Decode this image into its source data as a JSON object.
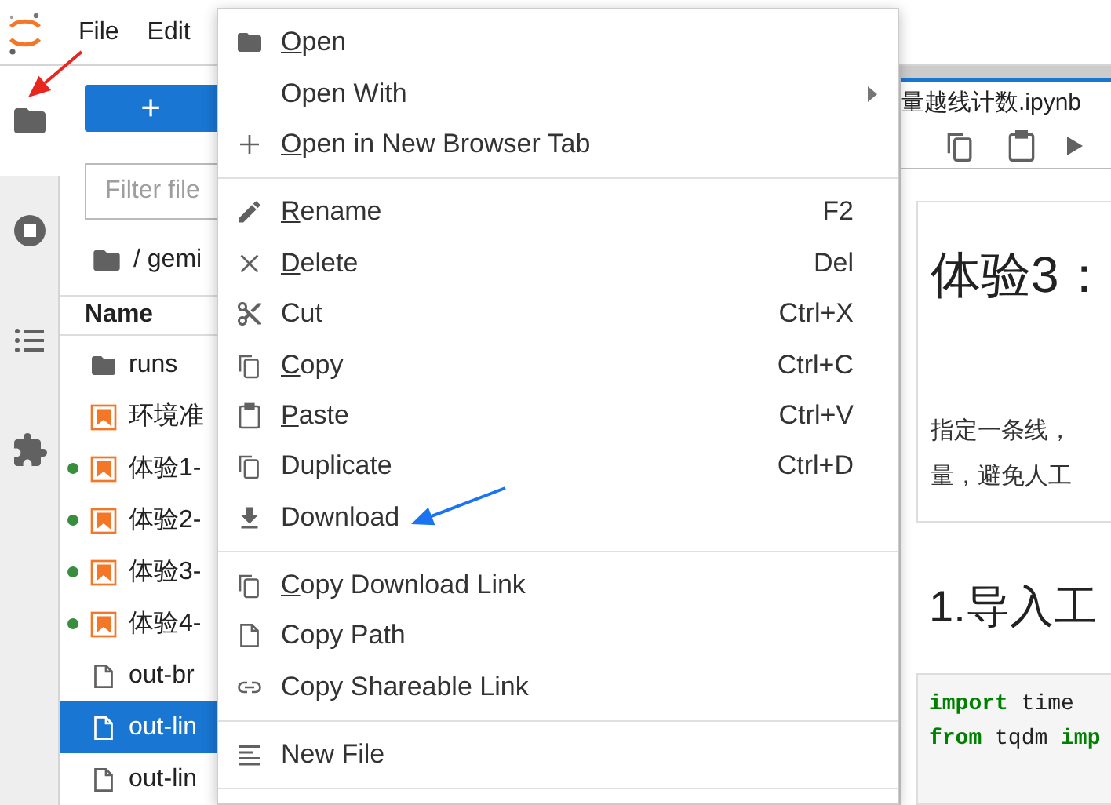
{
  "menubar": {
    "items": [
      "File",
      "Edit"
    ]
  },
  "sidebar_tabs": [
    {
      "selected": true
    },
    {
      "selected": false
    },
    {
      "selected": false
    },
    {
      "selected": false
    }
  ],
  "file_browser": {
    "new_button": "+",
    "filter": {
      "placeholder": "Filter file"
    },
    "breadcrumb": "/ gemi",
    "column_header": "Name",
    "rows": [
      {
        "kind": "folder",
        "name": "runs",
        "running": false,
        "selected": false
      },
      {
        "kind": "notebook",
        "name": "环境准",
        "running": false,
        "selected": false
      },
      {
        "kind": "notebook",
        "name": "体验1-",
        "running": true,
        "selected": false
      },
      {
        "kind": "notebook",
        "name": "体验2-",
        "running": true,
        "selected": false
      },
      {
        "kind": "notebook",
        "name": "体验3-",
        "running": true,
        "selected": false
      },
      {
        "kind": "notebook",
        "name": "体验4-",
        "running": true,
        "selected": false
      },
      {
        "kind": "file",
        "name": "out-br",
        "running": false,
        "selected": false
      },
      {
        "kind": "file",
        "name": "out-lin",
        "running": false,
        "selected": true
      },
      {
        "kind": "file",
        "name": "out-lin",
        "running": false,
        "selected": false
      }
    ]
  },
  "context_menu": {
    "sections": [
      [
        {
          "label": "Open",
          "mnemonic": true,
          "submenu": false
        },
        {
          "label": "Open With",
          "mnemonic": false,
          "submenu": true
        },
        {
          "label": "Open in New Browser Tab",
          "mnemonic": true,
          "submenu": false
        }
      ],
      [
        {
          "label": "Rename",
          "shortcut": "F2",
          "mnemonic": true,
          "submenu": false
        },
        {
          "label": "Delete",
          "shortcut": "Del",
          "mnemonic": true,
          "submenu": false
        },
        {
          "label": "Cut",
          "shortcut": "Ctrl+X",
          "mnemonic": false,
          "submenu": false
        },
        {
          "label": "Copy",
          "shortcut": "Ctrl+C",
          "mnemonic": true,
          "submenu": false
        },
        {
          "label": "Paste",
          "shortcut": "Ctrl+V",
          "mnemonic": true,
          "submenu": false
        },
        {
          "label": "Duplicate",
          "shortcut": "Ctrl+D",
          "mnemonic": false,
          "submenu": false
        },
        {
          "label": "Download",
          "mnemonic": false,
          "submenu": false
        }
      ],
      [
        {
          "label": "Copy Download Link",
          "mnemonic": true,
          "submenu": false
        },
        {
          "label": "Copy Path",
          "mnemonic": false,
          "submenu": false
        },
        {
          "label": "Copy Shareable Link",
          "mnemonic": false,
          "submenu": false
        }
      ],
      [
        {
          "label": "New File",
          "mnemonic": false,
          "submenu": false
        }
      ]
    ]
  },
  "notebook": {
    "tab_title": "量越线计数.ipynb",
    "cells": [
      {
        "kind": "markdown",
        "heading": "体验3：",
        "lines": [
          "指定一条线，",
          "量，避免人工"
        ]
      },
      {
        "kind": "heading",
        "heading": "1.导入工"
      },
      {
        "kind": "code",
        "lines": [
          "**import** time",
          "**from** tqdm **imp**"
        ]
      }
    ]
  },
  "annotations": [
    {
      "kind": "arrow",
      "color": "#e8251f"
    },
    {
      "kind": "arrow",
      "color": "#1a73f0"
    }
  ]
}
